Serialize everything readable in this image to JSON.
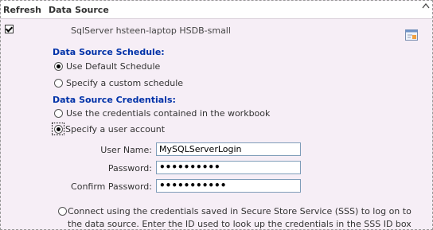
{
  "header": {
    "refresh_label": "Refresh",
    "data_source_label": "Data Source"
  },
  "row": {
    "refresh_checked": true,
    "data_source_name": "SqlServer hsteen-laptop HSDB-small"
  },
  "schedule": {
    "title": "Data Source Schedule:",
    "options": [
      {
        "label": "Use Default Schedule",
        "selected": true
      },
      {
        "label": "Specify a custom schedule",
        "selected": false
      }
    ]
  },
  "credentials": {
    "title": "Data Source Credentials:",
    "options": [
      {
        "label": "Use the credentials contained in the workbook",
        "selected": false
      },
      {
        "label": "Specify a user account",
        "selected": true
      }
    ],
    "user_name_label": "User Name:",
    "user_name_value": "MySQLServerLogin",
    "password_label": "Password:",
    "password_value": "••••••••••",
    "confirm_password_label": "Confirm Password:",
    "confirm_password_value": "•••••••••••",
    "sss_option_label": "Connect using the credentials saved in Secure Store Service (SSS) to log on to the data source. Enter the ID used to look up the credentials in the SSS ID box"
  }
}
